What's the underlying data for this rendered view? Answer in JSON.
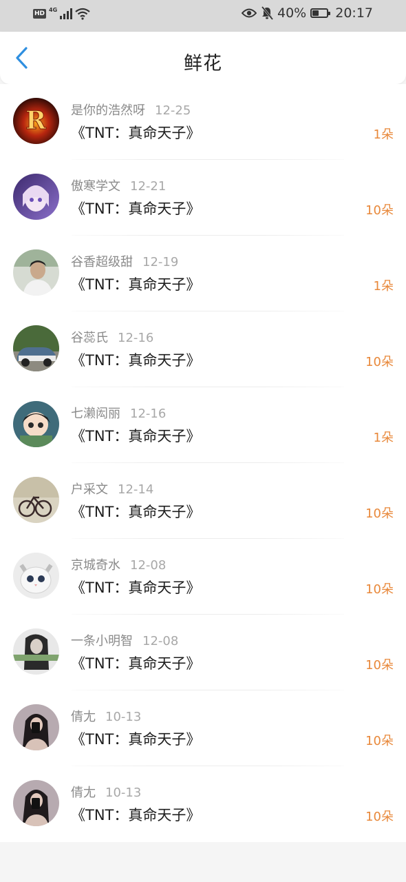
{
  "status_bar": {
    "hd": "HD",
    "network": "4G",
    "battery_text": "40%",
    "battery_level": 0.4,
    "time": "20:17",
    "icons": [
      "signal-icon",
      "wifi-icon",
      "eye-icon",
      "mute-bell-icon",
      "battery-icon"
    ]
  },
  "header": {
    "title": "鲜花",
    "back_icon": "chevron-left-icon",
    "accent_color": "#2f8fe0"
  },
  "colors": {
    "count": "#e8883a",
    "name": "#8a8a8a",
    "date": "#a8a8a8"
  },
  "items": [
    {
      "name": "是你的浩然呀",
      "date": "12-25",
      "book": "《TNT：真命天子》",
      "count": "1朵"
    },
    {
      "name": "傲寒学文",
      "date": "12-21",
      "book": "《TNT：真命天子》",
      "count": "10朵"
    },
    {
      "name": "谷香超级甜",
      "date": "12-19",
      "book": "《TNT：真命天子》",
      "count": "1朵"
    },
    {
      "name": "谷蕊氏",
      "date": "12-16",
      "book": "《TNT：真命天子》",
      "count": "10朵"
    },
    {
      "name": "七濑闳丽",
      "date": "12-16",
      "book": "《TNT：真命天子》",
      "count": "1朵"
    },
    {
      "name": "户采文",
      "date": "12-14",
      "book": "《TNT：真命天子》",
      "count": "10朵"
    },
    {
      "name": "京城奇水",
      "date": "12-08",
      "book": "《TNT：真命天子》",
      "count": "10朵"
    },
    {
      "name": "一条小明智",
      "date": "12-08",
      "book": "《TNT：真命天子》",
      "count": "10朵"
    },
    {
      "name": "倩尢",
      "date": "10-13",
      "book": "《TNT：真命天子》",
      "count": "10朵"
    },
    {
      "name": "倩尢",
      "date": "10-13",
      "book": "《TNT：真命天子》",
      "count": "10朵"
    }
  ]
}
